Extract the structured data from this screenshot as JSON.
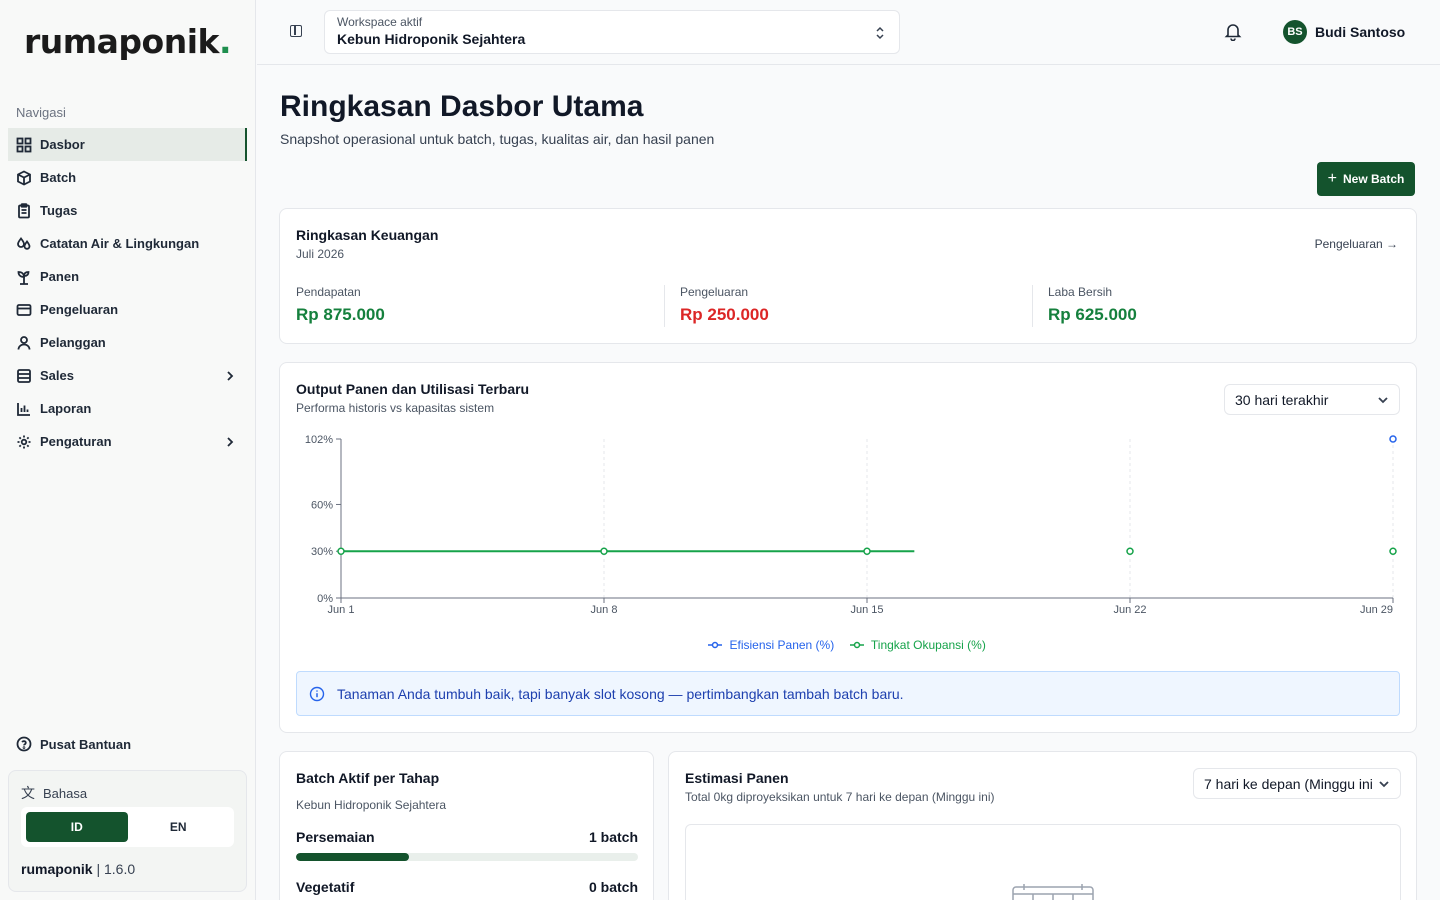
{
  "brand": {
    "name": "rumapon",
    "name_tail": "ik",
    "dot": "."
  },
  "sidebar": {
    "nav_title": "Navigasi",
    "items": [
      {
        "label": "Dasbor",
        "icon": "dashboard-icon",
        "active": true
      },
      {
        "label": "Batch",
        "icon": "box-icon"
      },
      {
        "label": "Tugas",
        "icon": "clipboard-icon"
      },
      {
        "label": "Catatan Air & Lingkungan",
        "icon": "droplet-icon"
      },
      {
        "label": "Panen",
        "icon": "sprout-icon"
      },
      {
        "label": "Pengeluaran",
        "icon": "credit-card-icon"
      },
      {
        "label": "Pelanggan",
        "icon": "user-icon"
      },
      {
        "label": "Sales",
        "icon": "database-icon",
        "has_submenu": true
      },
      {
        "label": "Laporan",
        "icon": "bar-chart-icon"
      },
      {
        "label": "Pengaturan",
        "icon": "gear-icon",
        "has_submenu": true
      }
    ],
    "help_label": "Pusat Bantuan",
    "language": {
      "title": "Bahasa",
      "options": [
        "ID",
        "EN"
      ],
      "selected": "ID"
    },
    "version": {
      "name": "rumaponik",
      "number": "1.6.0"
    }
  },
  "topbar": {
    "workspace_label": "Workspace aktif",
    "workspace_value": "Kebun Hidroponik Sejahtera",
    "user_initials": "BS",
    "user_name": "Budi Santoso"
  },
  "page": {
    "title": "Ringkasan Dasbor Utama",
    "subtitle": "Snapshot operasional untuk batch, tugas, kualitas air, dan hasil panen",
    "new_batch_label": "New Batch"
  },
  "finance": {
    "title": "Ringkasan Keuangan",
    "period": "Juli 2026",
    "link": "Pengeluaran →",
    "revenue": {
      "label": "Pendapatan",
      "value": "Rp 875.000",
      "color": "#15803d"
    },
    "expense": {
      "label": "Pengeluaran",
      "value": "Rp 250.000",
      "color": "#dc2626"
    },
    "profit": {
      "label": "Laba Bersih",
      "value": "Rp 625.000",
      "color": "#15803d"
    }
  },
  "chart_card": {
    "title": "Output Panen dan Utilisasi Terbaru",
    "subtitle": "Performa historis vs kapasitas sistem",
    "range_select": "30 hari terakhir",
    "alert": "Tanaman Anda tumbuh baik, tapi banyak slot kosong — pertimbangkan tambah batch baru."
  },
  "chart_data": {
    "type": "line",
    "x": [
      "Jun 1",
      "Jun 8",
      "Jun 15",
      "Jun 22",
      "Jun 29"
    ],
    "y_ticks": [
      "0%",
      "30%",
      "60%",
      "102%"
    ],
    "ylim": [
      0,
      102
    ],
    "grid": true,
    "legend_position": "bottom",
    "series": [
      {
        "name": "Efisiensi Panen (%)",
        "color": "#2563eb",
        "points": [
          {
            "x": "Jun 29",
            "y": 102
          }
        ]
      },
      {
        "name": "Tingkat Okupansi (%)",
        "color": "#16a34a",
        "points": [
          {
            "x": "Jun 1",
            "y": 30
          },
          {
            "x": "Jun 8",
            "y": 30
          },
          {
            "x": "Jun 15",
            "y": 30
          },
          {
            "x": "Jun 22",
            "y": 30
          },
          {
            "x": "Jun 29",
            "y": 30
          }
        ]
      }
    ]
  },
  "batch_card": {
    "title": "Batch Aktif per Tahap",
    "subtitle": "Kebun Hidroponik Sejahtera",
    "stages": [
      {
        "name": "Persemaian",
        "count": "1 batch",
        "fraction": 0.33
      },
      {
        "name": "Vegetatif",
        "count": "0 batch",
        "fraction": 0
      }
    ]
  },
  "estimate_card": {
    "title": "Estimasi Panen",
    "subtitle": "Total 0kg diproyeksikan untuk 7 hari ke depan (Minggu ini)",
    "range_select": "7 hari ke depan (Minggu ini)"
  }
}
